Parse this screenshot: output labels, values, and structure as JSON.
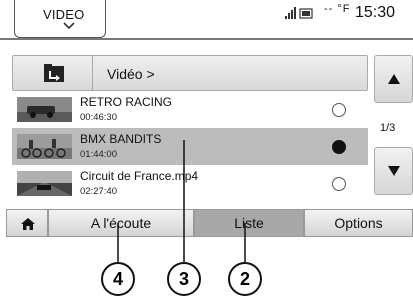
{
  "status_bar": {
    "source_label": "VIDEO",
    "dashes": "-- °F",
    "time": "15:30",
    "icons": [
      "signal-icon",
      "battery-icon"
    ]
  },
  "path_bar": {
    "back_icon": "folder-back-icon",
    "path": "Vidéo >"
  },
  "list": {
    "items": [
      {
        "title": "RETRO RACING",
        "duration": "00:46:30",
        "selected": false
      },
      {
        "title": "BMX BANDITS",
        "duration": "01:44:00",
        "selected": true
      },
      {
        "title": "Circuit de France.mp4",
        "duration": "02:27:40",
        "selected": false
      }
    ]
  },
  "scroll": {
    "page": "1/3",
    "up_icon": "arrow-up-icon",
    "down_icon": "arrow-down-icon"
  },
  "tabs": {
    "home_icon": "home-icon",
    "listen": "A l'écoute",
    "list": "Liste",
    "options": "Options",
    "active": "Liste"
  },
  "callouts": {
    "c4": "4",
    "c3": "3",
    "c2": "2"
  },
  "colors": {
    "selected_row": "#bcbcbc",
    "active_tab": "#a8a8a8"
  }
}
